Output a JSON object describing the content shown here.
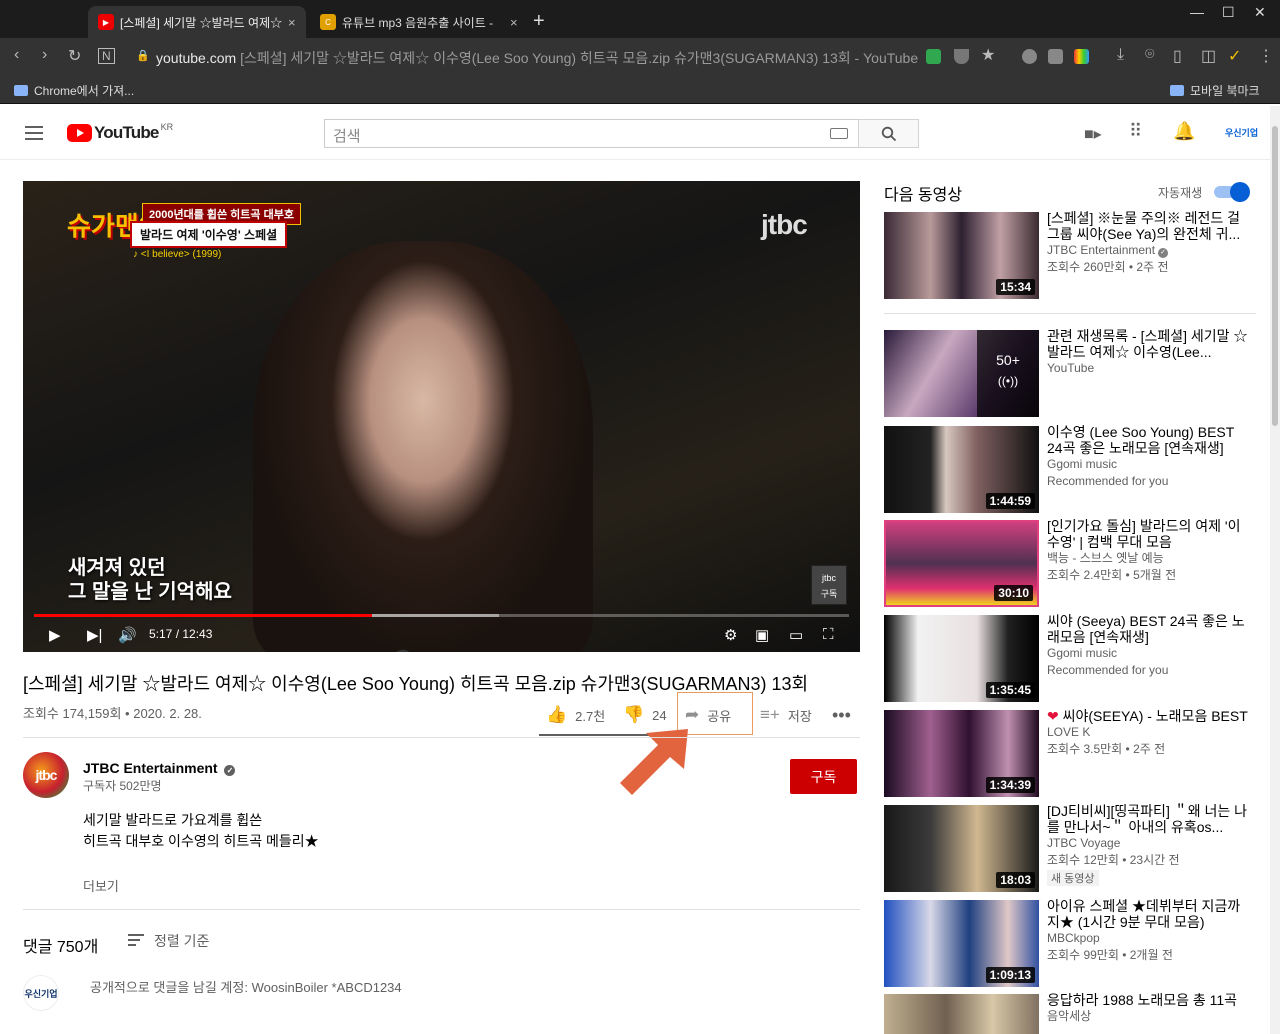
{
  "browser": {
    "tabs": [
      {
        "title": "[스페셜] 세기말 ☆발라드 여제☆",
        "active": true
      },
      {
        "title": "유튜브 mp3 음원추출 사이트 -",
        "active": false
      }
    ],
    "url_domain": "youtube.com",
    "url_rest": "[스페셜] 세기말 ☆발라드 여제☆ 이수영(Lee Soo Young) 히트곡 모음.zip 슈가맨3(SUGARMAN3) 13회 - YouTube",
    "bookmarks": {
      "left": "Chrome에서 가져...",
      "right": "모바일 북마크"
    }
  },
  "masthead": {
    "logo_text": "YouTube",
    "country": "KR",
    "search_placeholder": "검색",
    "account": "우신기업"
  },
  "player": {
    "show_name": "슈가맨3",
    "caption_top": "2000년대를 휩쓴 히트곡 대부호",
    "caption_main": "발라드 여제 '이수영' 스페셜",
    "song": "♪ <I believe> (1999)",
    "channel_watermark": "jtbc",
    "subtitle_line1": "새겨져 있던",
    "subtitle_line2": "그 말을 난 기억해요",
    "sub_badge_logo": "jtbc",
    "sub_badge_label": "구독",
    "time": "5:17 / 12:43",
    "progress_played": 0.415,
    "progress_buffered": 0.57
  },
  "video": {
    "title": "[스페셜] 세기말 ☆발라드 여제☆ 이수영(Lee Soo Young) 히트곡 모음.zip 슈가맨3(SUGARMAN3) 13회",
    "meta": "조회수 174,159회 • 2020. 2. 28.",
    "likes": "2.7천",
    "dislikes": "24",
    "share": "공유",
    "save": "저장"
  },
  "channel": {
    "avatar_text": "jtbc",
    "name": "JTBC Entertainment",
    "subs": "구독자 502만명",
    "subscribe": "구독",
    "desc_line1": "세기말 발라드로 가요계를 휩쓴",
    "desc_line2": "히트곡 대부호 이수영의 히트곡 메들리★",
    "more": "더보기"
  },
  "comments": {
    "count": "댓글 750개",
    "sort": "정렬 기준",
    "avatar_text": "우신기업",
    "placeholder": "공개적으로 댓글을 남길 계정: WoosinBoiler *ABCD1234"
  },
  "sidebar": {
    "up_next": "다음 동영상",
    "autoplay": "자동재생",
    "items": [
      {
        "title": "[스페셜] ※눈물 주의※ 레전드 걸그룹 씨야(See Ya)의 완전체 귀...",
        "channel": "JTBC Entertainment",
        "verified": true,
        "meta": "조회수 260만회 • 2주 전",
        "duration": "15:34"
      },
      {
        "title": "관련 재생목록 - [스페셜] 세기말 ☆발라드 여제☆ 이수영(Lee...",
        "channel": "YouTube",
        "meta": "",
        "playlist_count": "50+"
      },
      {
        "title": "이수영 (Lee Soo Young) BEST 24곡 좋은 노래모음 [연속재생]",
        "channel": "Ggomi music",
        "meta": "Recommended for you",
        "duration": "1:44:59"
      },
      {
        "title": "[인기가요 돌심] 발라드의 여제 '이수영' | 컴백 무대 모음",
        "channel": "백능 - 스브스 옛날 예능",
        "meta": "조회수 2.4만회 • 5개월 전",
        "duration": "30:10"
      },
      {
        "title": "씨야 (Seeya) BEST 24곡 좋은 노래모음 [연속재생]",
        "channel": "Ggomi music",
        "meta": "Recommended for you",
        "duration": "1:35:45"
      },
      {
        "title": "씨야(SEEYA) - 노래모음 BEST",
        "channel": "LOVE K",
        "meta": "조회수 3.5만회 • 2주 전",
        "duration": "1:34:39"
      },
      {
        "title": "[DJ티비씨][띵곡파티] ＂왜 너는 나를 만나서~＂ 아내의 유혹os...",
        "channel": "JTBC Voyage",
        "meta": "조회수 12만회 • 23시간 전",
        "badge": "새 동영상",
        "duration": "18:03"
      },
      {
        "title": "아이유 스페셜 ★데뷔부터 지금까지★ (1시간 9분 무대 모음)",
        "channel": "MBCkpop",
        "meta": "조회수 99만회 • 2개월 전",
        "duration": "1:09:13"
      },
      {
        "title": "응답하라 1988 노래모음 총 11곡",
        "channel": "음악세상",
        "meta": ""
      }
    ]
  }
}
